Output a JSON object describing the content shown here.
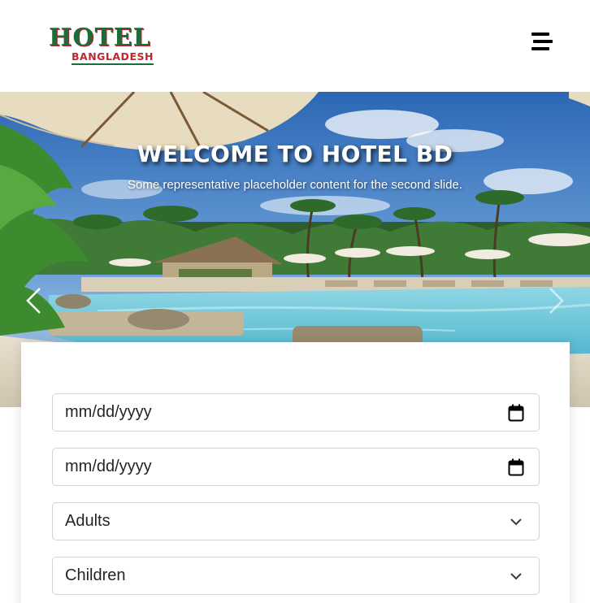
{
  "header": {
    "logo_top": "HOTEL",
    "logo_bottom": "BANGLADESH"
  },
  "hero": {
    "title": "WELCOME TO HOTEL BD",
    "subtitle": "Some representative placeholder content for the second slide."
  },
  "booking": {
    "checkin_placeholder": "mm/dd/yyyy",
    "checkout_placeholder": "mm/dd/yyyy",
    "adults_label": "Adults",
    "children_label": "Children"
  },
  "icons": {
    "menu": "hamburger-icon",
    "prev": "chevron-left-icon",
    "next": "chevron-right-icon",
    "calendar": "calendar-icon",
    "dropdown": "chevron-down-icon"
  }
}
